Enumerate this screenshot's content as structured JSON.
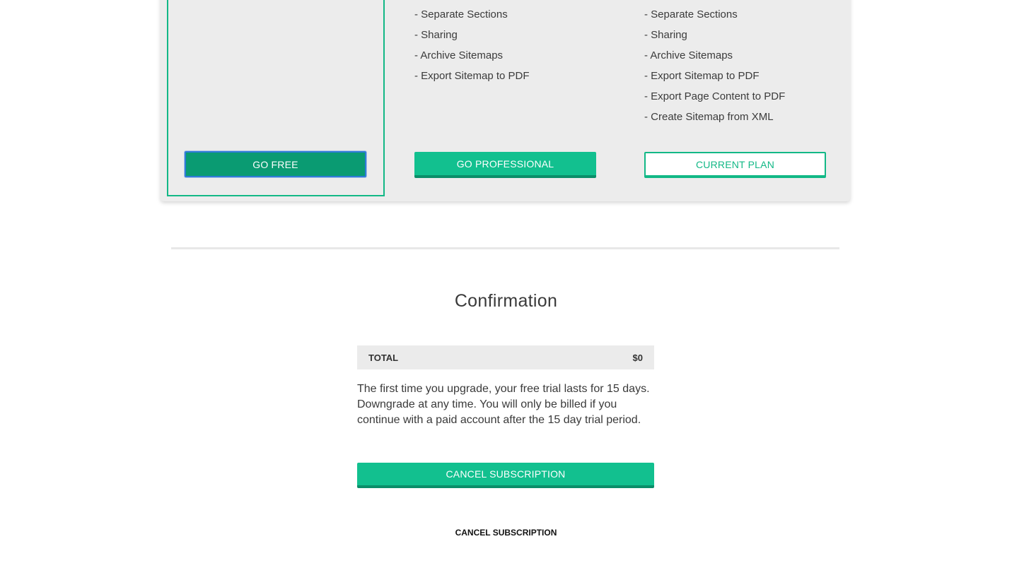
{
  "plans": {
    "free": {
      "features": [],
      "button_label": "GO FREE"
    },
    "professional": {
      "features": [
        "- Separate Sections",
        "- Sharing",
        "- Archive Sitemaps",
        "- Export Sitemap to PDF"
      ],
      "button_label": "GO PROFESSIONAL"
    },
    "current": {
      "features": [
        "- Separate Sections",
        "- Sharing",
        "- Archive Sitemaps",
        "- Export Sitemap to PDF",
        "- Export Page Content to PDF",
        "- Create Sitemap from XML"
      ],
      "button_label": "CURRENT PLAN"
    }
  },
  "confirmation": {
    "title": "Confirmation",
    "total_label": "TOTAL",
    "total_value": "$0",
    "note": "The first time you upgrade, your free trial lasts for 15 days. Downgrade at any time. You will only be billed if you continue with a paid account after the 15 day trial period.",
    "cancel_button_label": "CANCEL SUBSCRIPTION",
    "cancel_link_label": "CANCEL SUBSCRIPTION"
  },
  "colors": {
    "accent": "#12c08f",
    "accent_dark": "#0a8e69",
    "free_button": "#0a9b72",
    "focus_ring": "#2f7bd8",
    "panel_bg": "#ececec"
  }
}
